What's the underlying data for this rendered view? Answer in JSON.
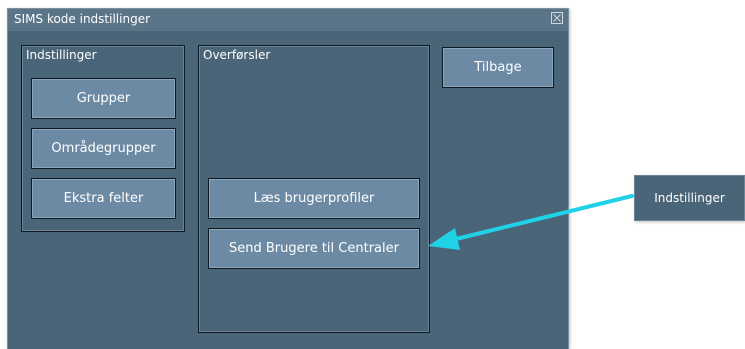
{
  "window": {
    "title": "SIMS kode indstillinger",
    "close_icon": "close-icon"
  },
  "settings_group": {
    "label": "Indstillinger",
    "buttons": [
      "Grupper",
      "Områdegrupper",
      "Ekstra felter"
    ]
  },
  "transfers_group": {
    "label": "Overførsler",
    "buttons": [
      "Læs brugerprofiler",
      "Send Brugere til Centraler"
    ]
  },
  "back_button": {
    "label": "Tilbage"
  },
  "callout": {
    "label": "Indstillinger",
    "arrow_color": "#1fd2e8"
  },
  "colors": {
    "window_background": "#4a6478",
    "titlebar": "#5a7488",
    "button": "#6c8aa4"
  }
}
